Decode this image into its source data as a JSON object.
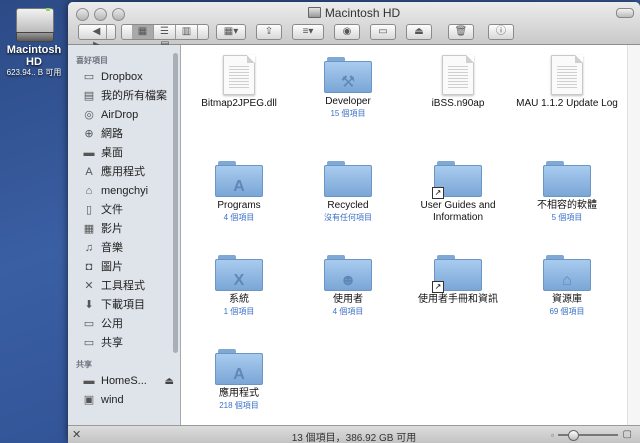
{
  "desktop": {
    "drive_name": "Macintosh HD",
    "drive_info": "623.94.. B 可用"
  },
  "window": {
    "title": "Macintosh HD"
  },
  "sidebar": {
    "favorites_header": "喜好項目",
    "favorites": [
      {
        "label": "Dropbox",
        "icon": "folder-icon"
      },
      {
        "label": "我的所有檔案",
        "icon": "all-files-icon"
      },
      {
        "label": "AirDrop",
        "icon": "airdrop-icon"
      },
      {
        "label": "網路",
        "icon": "network-icon"
      },
      {
        "label": "桌面",
        "icon": "desktop-icon"
      },
      {
        "label": "應用程式",
        "icon": "applications-icon"
      },
      {
        "label": "mengchyi",
        "icon": "home-icon"
      },
      {
        "label": "文件",
        "icon": "documents-icon"
      },
      {
        "label": "影片",
        "icon": "movies-icon"
      },
      {
        "label": "音樂",
        "icon": "music-icon"
      },
      {
        "label": "圖片",
        "icon": "pictures-icon"
      },
      {
        "label": "工具程式",
        "icon": "utilities-icon"
      },
      {
        "label": "下載項目",
        "icon": "downloads-icon"
      },
      {
        "label": "公用",
        "icon": "folder-icon"
      },
      {
        "label": "共享",
        "icon": "folder-icon"
      }
    ],
    "shared_header": "共享",
    "shared": [
      {
        "label": "HomeS...",
        "icon": "server-icon"
      },
      {
        "label": "wind",
        "icon": "computer-icon"
      }
    ]
  },
  "items": [
    {
      "name": "Bitmap2JPEG.dll",
      "sub": "",
      "kind": "document"
    },
    {
      "name": "Developer",
      "sub": "15 個項目",
      "kind": "folder",
      "emblem": "developer"
    },
    {
      "name": "iBSS.n90ap",
      "sub": "",
      "kind": "document"
    },
    {
      "name": "MAU 1.1.2 Update Log",
      "sub": "",
      "kind": "document-log"
    },
    {
      "name": "Programs",
      "sub": "4 個項目",
      "kind": "folder",
      "emblem": "applications"
    },
    {
      "name": "Recycled",
      "sub": "沒有任何項目",
      "kind": "folder"
    },
    {
      "name": "User Guides and Information",
      "sub": "",
      "kind": "folder-alias"
    },
    {
      "name": "不相容的軟體",
      "sub": "5 個項目",
      "kind": "folder"
    },
    {
      "name": "系統",
      "sub": "1 個項目",
      "kind": "folder",
      "emblem": "system"
    },
    {
      "name": "使用者",
      "sub": "4 個項目",
      "kind": "folder",
      "emblem": "users"
    },
    {
      "name": "使用者手冊和資訊",
      "sub": "",
      "kind": "folder-alias"
    },
    {
      "name": "資源庫",
      "sub": "69 個項目",
      "kind": "folder",
      "emblem": "library"
    },
    {
      "name": "應用程式",
      "sub": "218 個項目",
      "kind": "folder",
      "emblem": "applications"
    }
  ],
  "statusbar": {
    "text": "13 個項目，386.92 GB 可用",
    "icon_size_fraction": 0.2
  },
  "colors": {
    "sidebar_bg": "#dfe4ea",
    "folder": "#8fb8e3",
    "item_count": "#3b71c8"
  }
}
